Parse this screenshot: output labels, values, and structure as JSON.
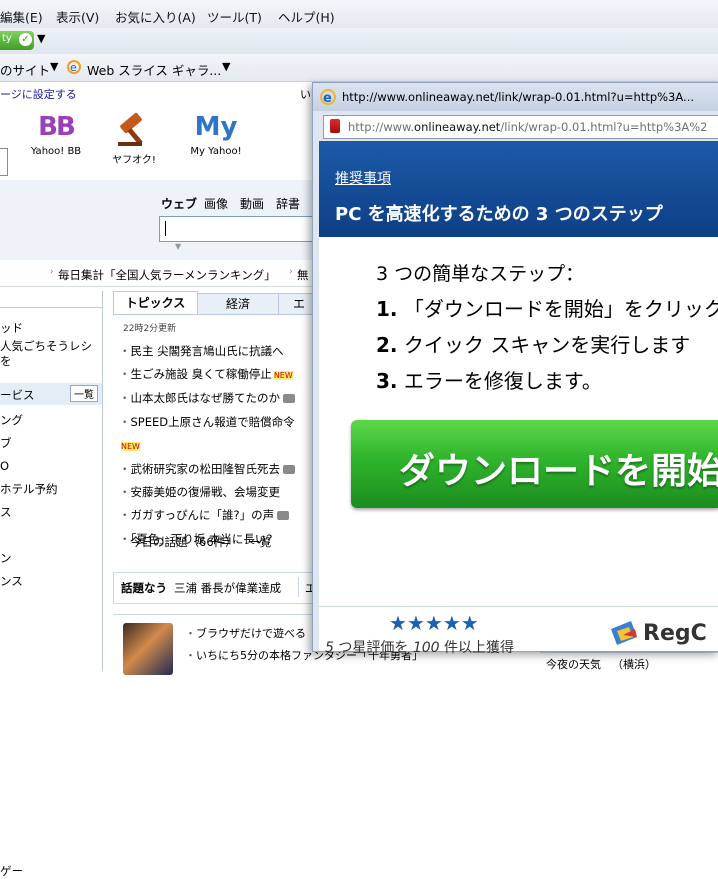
{
  "menu": [
    "編集(E)",
    "表示(V)",
    "お気に入り(A)",
    "ツール(T)",
    "ヘルプ(H)"
  ],
  "favorites": {
    "left_fragment": "のサイト",
    "item": "Web スライス ギャラ..."
  },
  "page": {
    "set_home": "ージに設定する",
    "services": [
      {
        "label": "Yahoo! BB",
        "icon": "bb-logo-icon"
      },
      {
        "label": "ヤフオク!",
        "icon": "auction-gavel-icon"
      },
      {
        "label": "My Yahoo!",
        "icon": "my-logo-icon"
      }
    ],
    "search_tabs": [
      "ウェブ",
      "画像",
      "動画",
      "辞書"
    ],
    "ticker": [
      "毎日集計「全国人気ラーメンランキング」",
      "無"
    ],
    "left_nav": [
      "ッド",
      "人気ごちそうレシ",
      "を",
      "ービス",
      "ング",
      "ブ",
      "O",
      "ホテル予約",
      "ス",
      "ン",
      "ンス",
      "ゲー"
    ],
    "left_nav_more": "一覧",
    "topics": {
      "tabs": [
        "トピックス",
        "経済",
        "エ"
      ],
      "updated": "22時2分更新",
      "items": [
        {
          "text": "民主 尖閣発言鳩山氏に抗議へ",
          "badge": ""
        },
        {
          "text": "生ごみ施設 臭くて稼働停止",
          "badge": "NEW"
        },
        {
          "text": "山本太郎氏はなぜ勝てたのか",
          "badge": "camera"
        },
        {
          "text": "SPEED上原さん報道で賠償命令",
          "badge": "NEW"
        },
        {
          "text": "武術研究家の松田隆智氏死去",
          "badge": "camera-new"
        },
        {
          "text": "安藤美姫の復帰戦、会場変更",
          "badge": ""
        },
        {
          "text": "ガガすっぴんに「誰?」の声",
          "badge": "camera"
        },
        {
          "text": "「夏色」下り坂 本当に長い?",
          "badge": ""
        }
      ],
      "today": "今日の話題（66件）",
      "today_list": "一覧"
    },
    "wadai": {
      "label": "話題なう",
      "text": "三浦 番長が偉業達成",
      "after": "エ"
    },
    "promos": [
      "ブラウザだけで遊べる「",
      "いちにち5分の本格ファンタジー「千年勇者」"
    ],
    "weather": {
      "label": "今夜の天気",
      "place": "（横浜）"
    }
  },
  "popup": {
    "title_url": "http://www.onlineaway.net/link/wrap-0.01.html?u=http%3A...",
    "addr_prefix": "http://www.",
    "addr_domain": "onlineaway.net",
    "addr_rest": "/link/wrap-0.01.html?u=http%3A%2",
    "ad": {
      "recommend": "推奨事項",
      "headline": "PC を高速化するための 3 つのステップ",
      "subhead": "3 つの簡単なステップ：",
      "steps": [
        {
          "num": "1.",
          "text": "「ダウンロードを開始」をクリック"
        },
        {
          "num": "2.",
          "text": "クイック スキャンを実行します"
        },
        {
          "num": "3.",
          "text": "エラーを修復します。"
        }
      ],
      "download_button": "ダウンロードを開始",
      "rating_count": "5",
      "rating_text": "つ星評価を",
      "rating_num": "100",
      "rating_tail": "件以上獲得",
      "brand": "RegC"
    }
  }
}
